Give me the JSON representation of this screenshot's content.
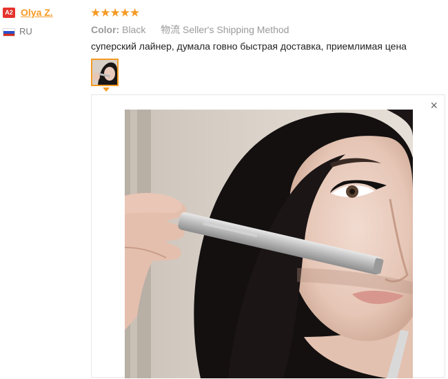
{
  "reviewer": {
    "level_badge": "A2",
    "name": "Olya Z.",
    "country": "RU"
  },
  "review": {
    "rating": 5,
    "stars_text": "★★★★★",
    "color_label": "Color:",
    "color_value": "Black",
    "shipping_method": "物流 Seller's Shipping Method",
    "text": "суперский лайнер, думала говно быстрая доставка, приемлимая цена"
  },
  "viewer": {
    "close_icon": "×"
  },
  "colors": {
    "badge_bg": "#e5322d",
    "username": "#f59a23",
    "stars": "#f59a23",
    "thumb_border": "#f59a23"
  },
  "icons": [
    "flag-ru-icon",
    "star-icon",
    "close-icon"
  ]
}
